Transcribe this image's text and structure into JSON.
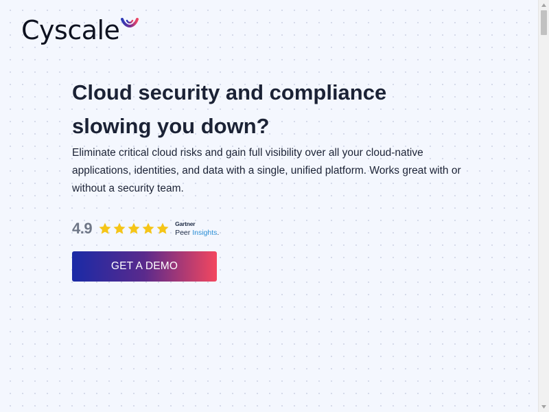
{
  "header": {
    "logo_text": "Cyscale",
    "logo_mark_icon": "cyscale-wing-mark-icon"
  },
  "hero": {
    "title": "Cloud security and compliance slowing you down?",
    "description": "Eliminate critical cloud risks and gain full visibility over all your cloud-native applications, identities, and data with a single, unified platform. Works great with or without a security team."
  },
  "rating": {
    "score": "4.9",
    "stars": 5,
    "star_icon": "star-icon",
    "star_color": "#f5c518",
    "brand": "Gartner",
    "product_part1": "Peer",
    "product_part2": "Insights",
    "product_suffix": "."
  },
  "cta": {
    "label": "GET A DEMO"
  },
  "colors": {
    "background": "#f4f7fe",
    "text": "#1b2235",
    "cta_gradient_start": "#1a2aa6",
    "cta_gradient_end": "#f3475f",
    "insights_accent": "#2b8fd6"
  }
}
